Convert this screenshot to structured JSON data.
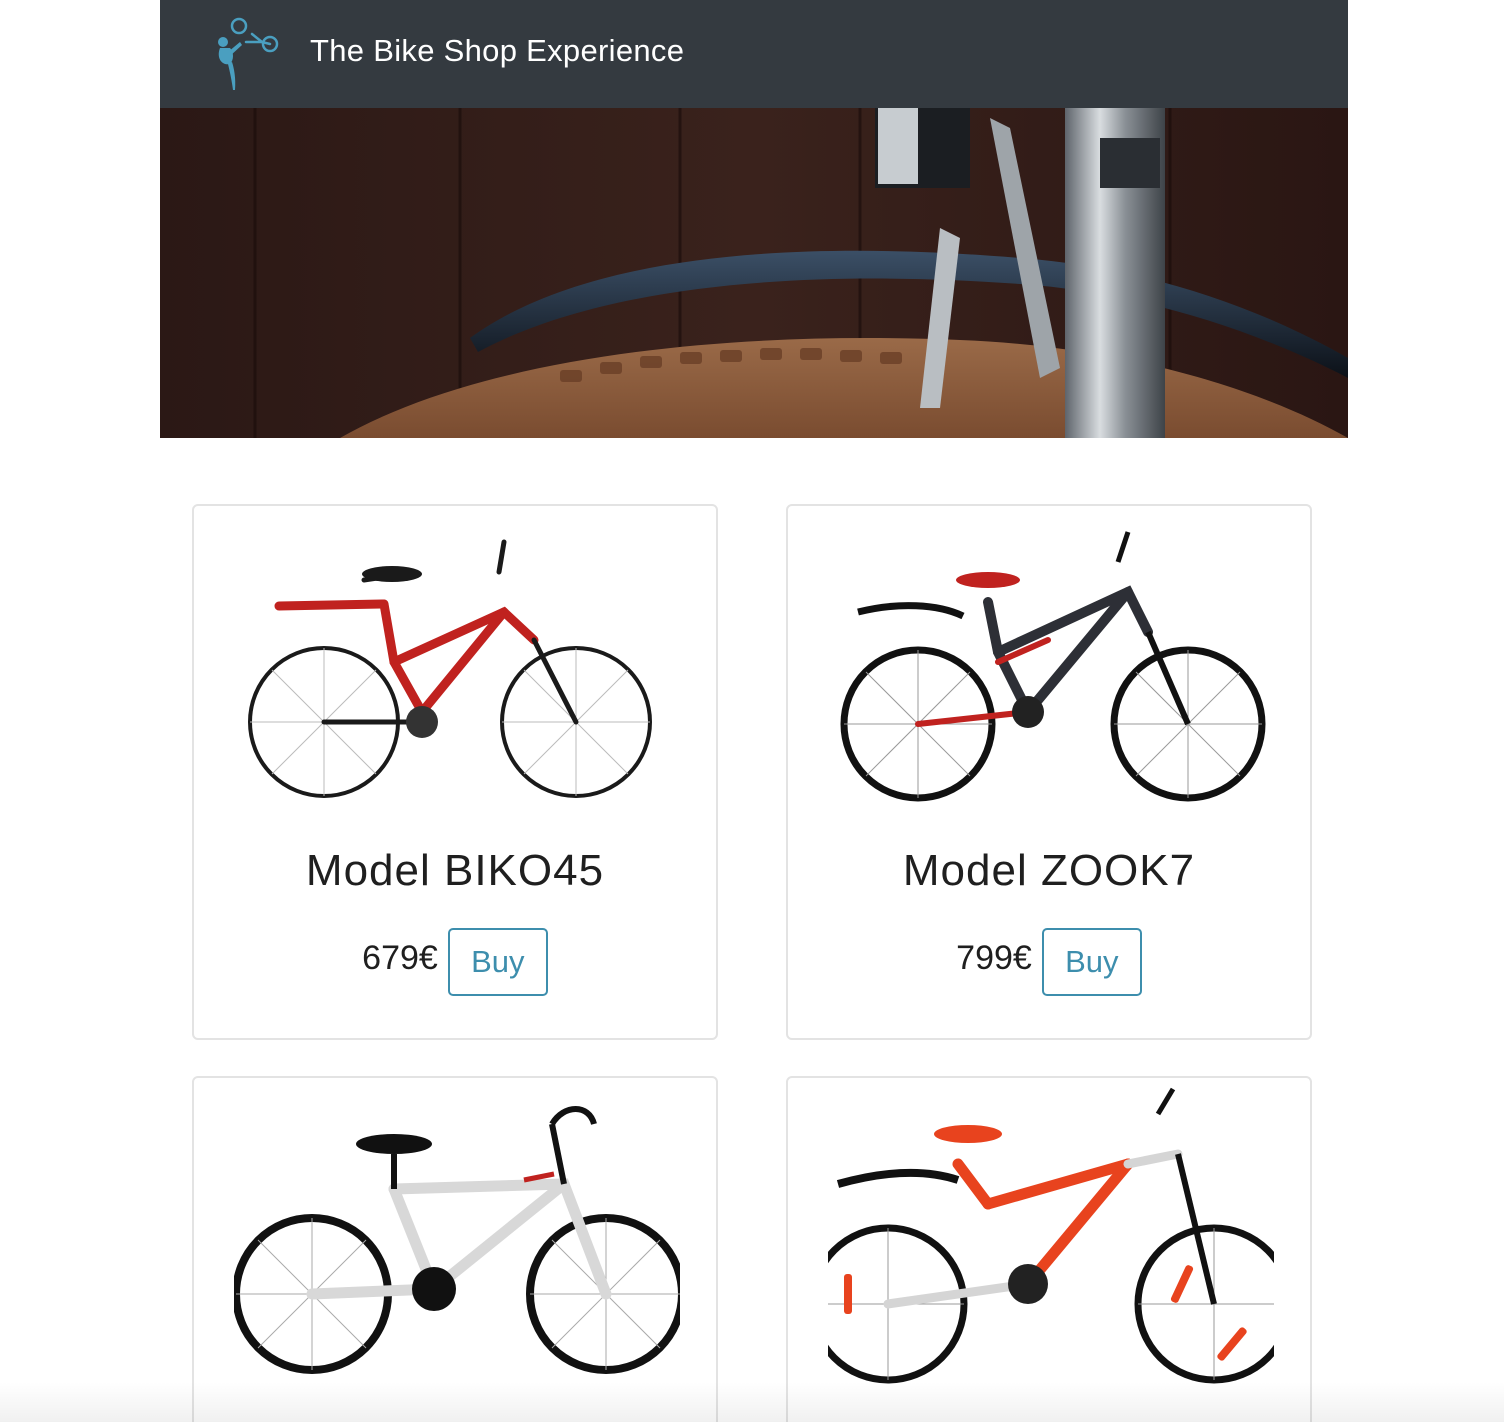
{
  "navbar": {
    "brand": "The Bike Shop Experience",
    "logo_icon": "cyclist-logo-icon",
    "bg_color": "#343a40",
    "logo_color": "#4a9fc0"
  },
  "hero": {
    "image_icon": "bike-wheel-closeup-photo"
  },
  "products": [
    {
      "name": "Model BIKO45",
      "price": "679€",
      "buy_label": "Buy",
      "frame_color": "#c0221f",
      "image_icon": "red-bicycle-image"
    },
    {
      "name": "Model ZOOK7",
      "price": "799€",
      "buy_label": "Buy",
      "frame_color": "#2d2f36",
      "image_icon": "black-bicycle-image"
    },
    {
      "name": "",
      "price": "",
      "buy_label": "",
      "frame_color": "#f2f2f2",
      "image_icon": "white-bicycle-image"
    },
    {
      "name": "",
      "price": "",
      "buy_label": "",
      "frame_color": "#e8431e",
      "image_icon": "orange-bicycle-image"
    }
  ],
  "colors": {
    "accent": "#3d8ead"
  }
}
